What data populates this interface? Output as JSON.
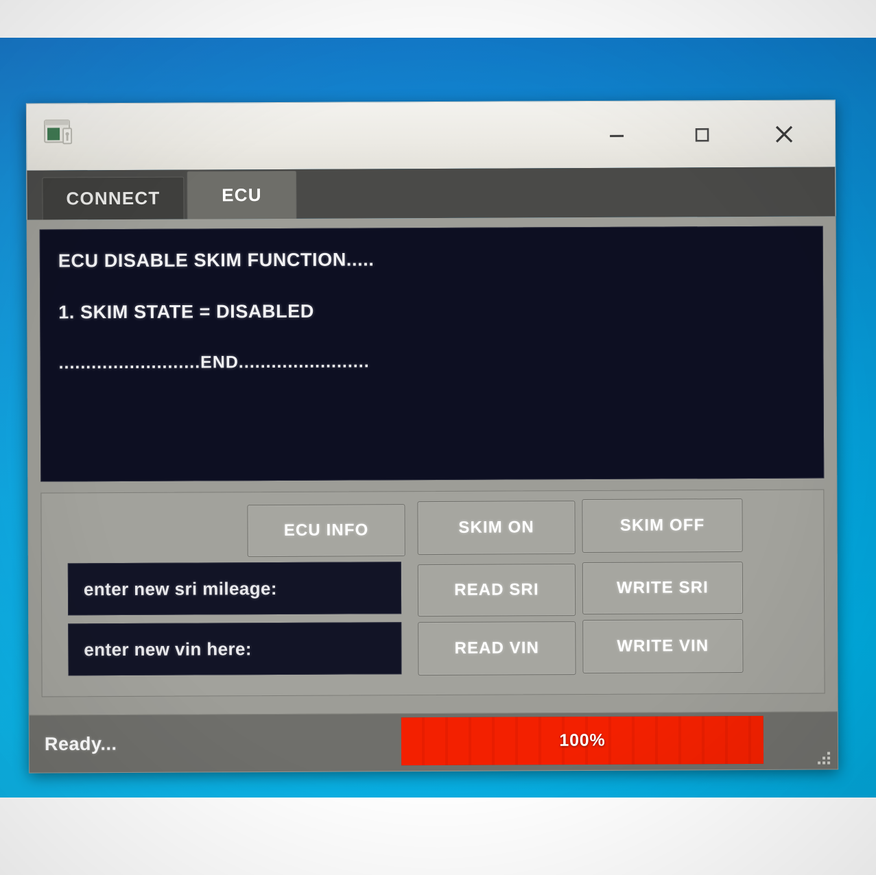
{
  "window": {
    "title": "",
    "icon": "app-window-icon",
    "controls": {
      "minimize": "minimize-icon",
      "maximize": "maximize-icon",
      "close": "close-icon"
    }
  },
  "tabs": [
    {
      "label": "CONNECT",
      "active": false
    },
    {
      "label": "ECU",
      "active": true
    }
  ],
  "console": {
    "lines": [
      "ECU DISABLE SKIM FUNCTION.....",
      "1. SKIM STATE = DISABLED",
      "..........................END........................"
    ]
  },
  "panel": {
    "buttons": {
      "ecu_info": "ECU INFO",
      "skim_on": "SKIM ON",
      "skim_off": "SKIM OFF",
      "read_sri": "READ SRI",
      "write_sri": "WRITE SRI",
      "read_vin": "READ VIN",
      "write_vin": "WRITE VIN"
    },
    "fields": {
      "sri_mileage": {
        "value": "enter new sri mileage:",
        "placeholder": "enter new sri mileage:"
      },
      "vin": {
        "value": "enter new vin here:",
        "placeholder": "enter new vin here:"
      }
    }
  },
  "statusbar": {
    "status": "Ready...",
    "progress_label": "100%",
    "progress_percent": 100,
    "progress_color": "#f32000",
    "resize_grip": "resize-grip-icon"
  },
  "theme": {
    "desktop_blue_top": "#0b72c9",
    "desktop_blue_bottom": "#00b3ea",
    "window_body_gray": "#9d9d97",
    "tabstrip_dark": "#4a4a48",
    "console_navy": "#0d0f22",
    "statusbar_gray": "#6f6f6b"
  }
}
